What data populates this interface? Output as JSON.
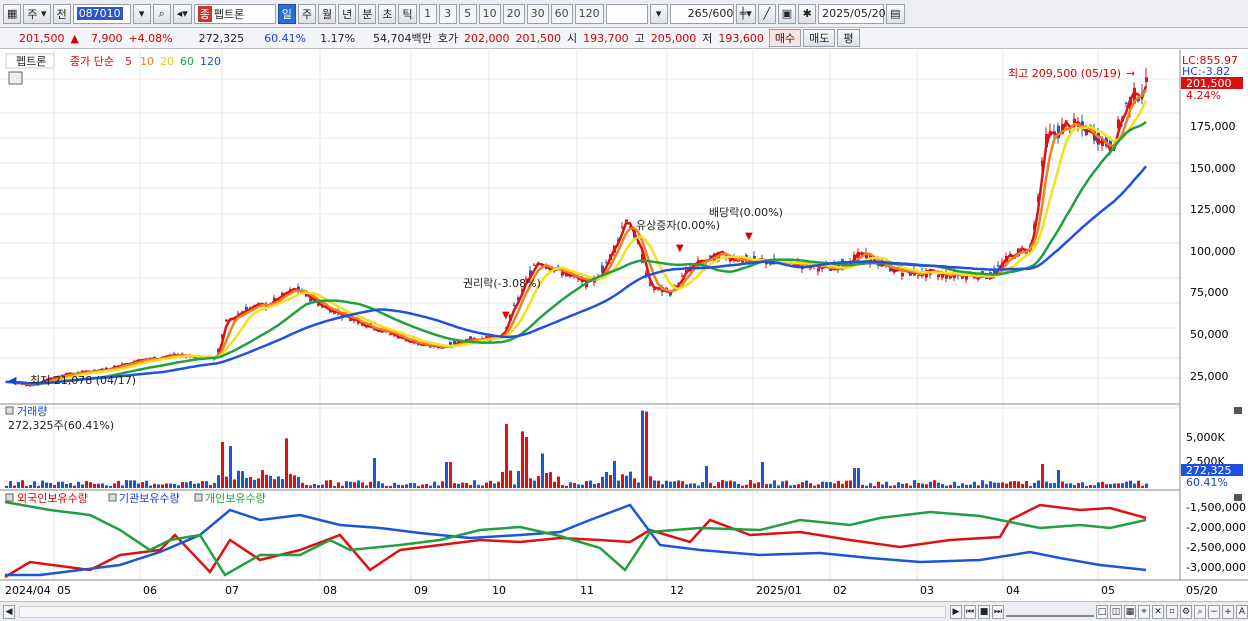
{
  "toolbar": {
    "mode": "주",
    "type": "전",
    "code": "087010",
    "name": "펩트론",
    "tab_day": "일",
    "tab_week": "주",
    "tab_month": "월",
    "tab_year": "년",
    "tab_min": "분",
    "tab_sec": "초",
    "tab_tick": "틱",
    "periods": [
      "1",
      "3",
      "5",
      "10",
      "20",
      "30",
      "60",
      "120"
    ],
    "count": "265",
    "count_total": "/600",
    "date": "2025/05/20"
  },
  "quote": {
    "price": "201,500",
    "arrow": "▲",
    "change": "7,900",
    "pct": "+4.08%",
    "volume": "272,325",
    "vol_ratio": "60.41%",
    "turnover": "1.17%",
    "amount": "54,704백만",
    "bid_label": "호가",
    "bid1": "202,000",
    "bid2": "201,500",
    "open_label": "시",
    "open": "193,700",
    "high_label": "고",
    "high": "205,000",
    "low_label": "저",
    "low": "193,600",
    "buy": "매수",
    "sell": "매도",
    "avg": "평"
  },
  "price_panel": {
    "stock": "펩트론",
    "ma_label": "종가 단순",
    "ma_periods": [
      "5",
      "10",
      "20",
      "60",
      "120"
    ],
    "lc": "LC:855.97",
    "hc": "HC:-3.82",
    "cur_price": "201,500",
    "cur_pct": "4.24%",
    "max_label": "최고 209,500 (05/19)",
    "min_label": "최저 21,078 (04/17)",
    "annotations": [
      "권리락(-3.08%)",
      "유상증자(0.00%)",
      "배당락(0.00%)"
    ],
    "yticks": [
      "175,000",
      "150,000",
      "125,000",
      "100,000",
      "75,000",
      "50,000",
      "25,000"
    ]
  },
  "volume_panel": {
    "title": "거래량",
    "value": "272,325주(60.41%)",
    "yticks": [
      "5,000K",
      "2,500K"
    ],
    "cur": "272,325",
    "cur_pct": "60.41%"
  },
  "holding_panel": {
    "legend": [
      "외국인보유수량",
      "기관보유수량",
      "개인보유수량"
    ],
    "yticks": [
      "-1,500,000",
      "-2,000,000",
      "-2,500,000",
      "-3,000,000"
    ]
  },
  "xaxis": {
    "labels": [
      "2024/04",
      "05",
      "06",
      "07",
      "08",
      "09",
      "10",
      "11",
      "12",
      "2025/01",
      "02",
      "03",
      "04",
      "05"
    ],
    "right": "05/20"
  },
  "colors": {
    "up": "#e01010",
    "down": "#1a56d8",
    "ma5": "#e01010",
    "ma10": "#f08020",
    "ma20": "#f4e020",
    "ma60": "#20a040",
    "ma120": "#2050e0"
  },
  "chart_data": {
    "type": "candlestick",
    "series": [
      {
        "name": "종가",
        "period": "2024/04-2025/05",
        "approx_close_by_month": {
          "2024/04": 24000,
          "05": 201500,
          "06": 38000,
          "07": 70000,
          "08": 62000,
          "09": 45000,
          "10": 90000,
          "11": 120000,
          "12": 90000,
          "2025/01": 97000,
          "02": 95000,
          "03": 92000,
          "04": 170000
        }
      }
    ]
  }
}
